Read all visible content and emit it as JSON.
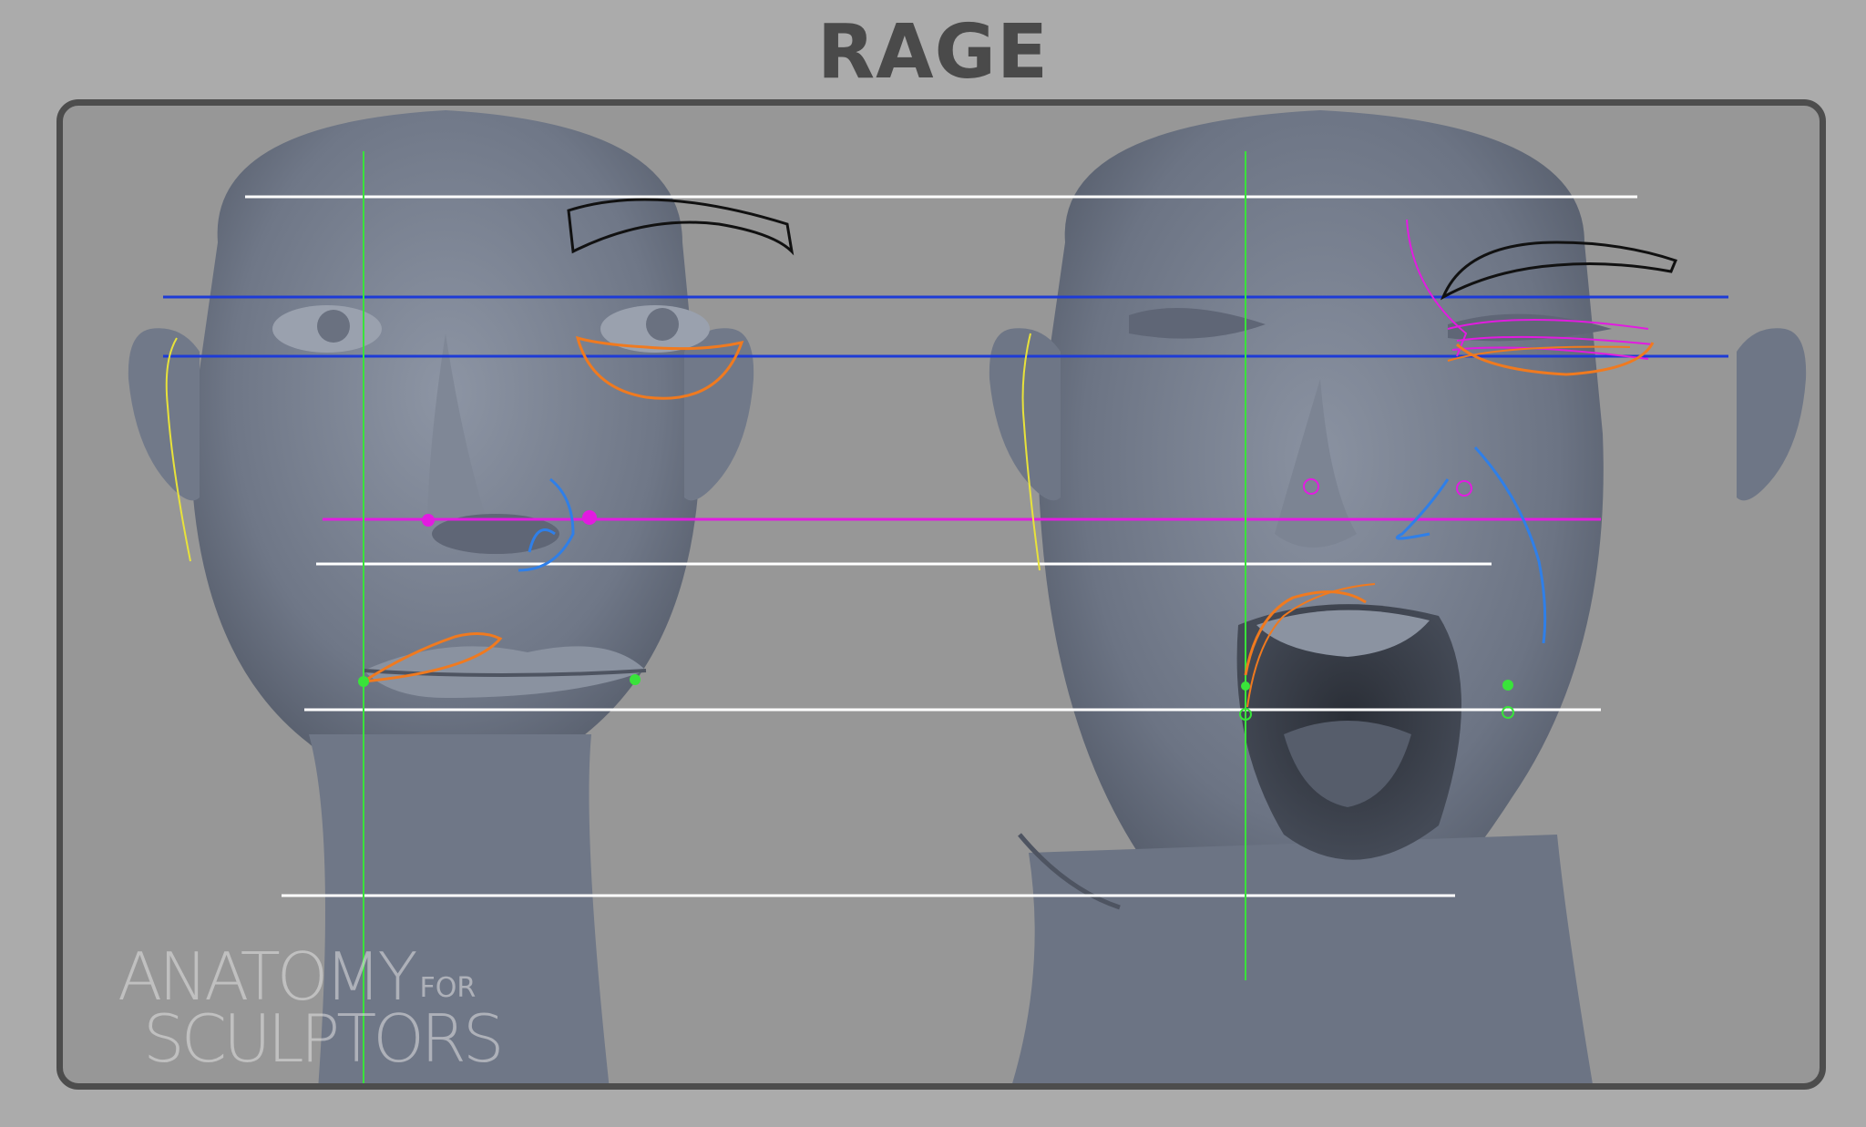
{
  "title": "RAGE",
  "watermark": {
    "line1": "ANATOMY",
    "line1_suffix": "FOR",
    "line2": "SCULPTORS"
  },
  "colors": {
    "background": "#ababab",
    "panel": "#979797",
    "panel_border": "#4d4d4d",
    "skin": "#7c8493",
    "guide_white": "#ffffff",
    "guide_blue": "#1d3bd6",
    "guide_magenta": "#e21be0",
    "guide_green": "#39e33a",
    "guide_orange": "#f07a1f",
    "guide_cyan": "#2f7fe8",
    "guide_yellow": "#e8e23a",
    "brow_outline": "#111111"
  },
  "panels": {
    "left": "neutral face",
    "right": "rage expression"
  }
}
